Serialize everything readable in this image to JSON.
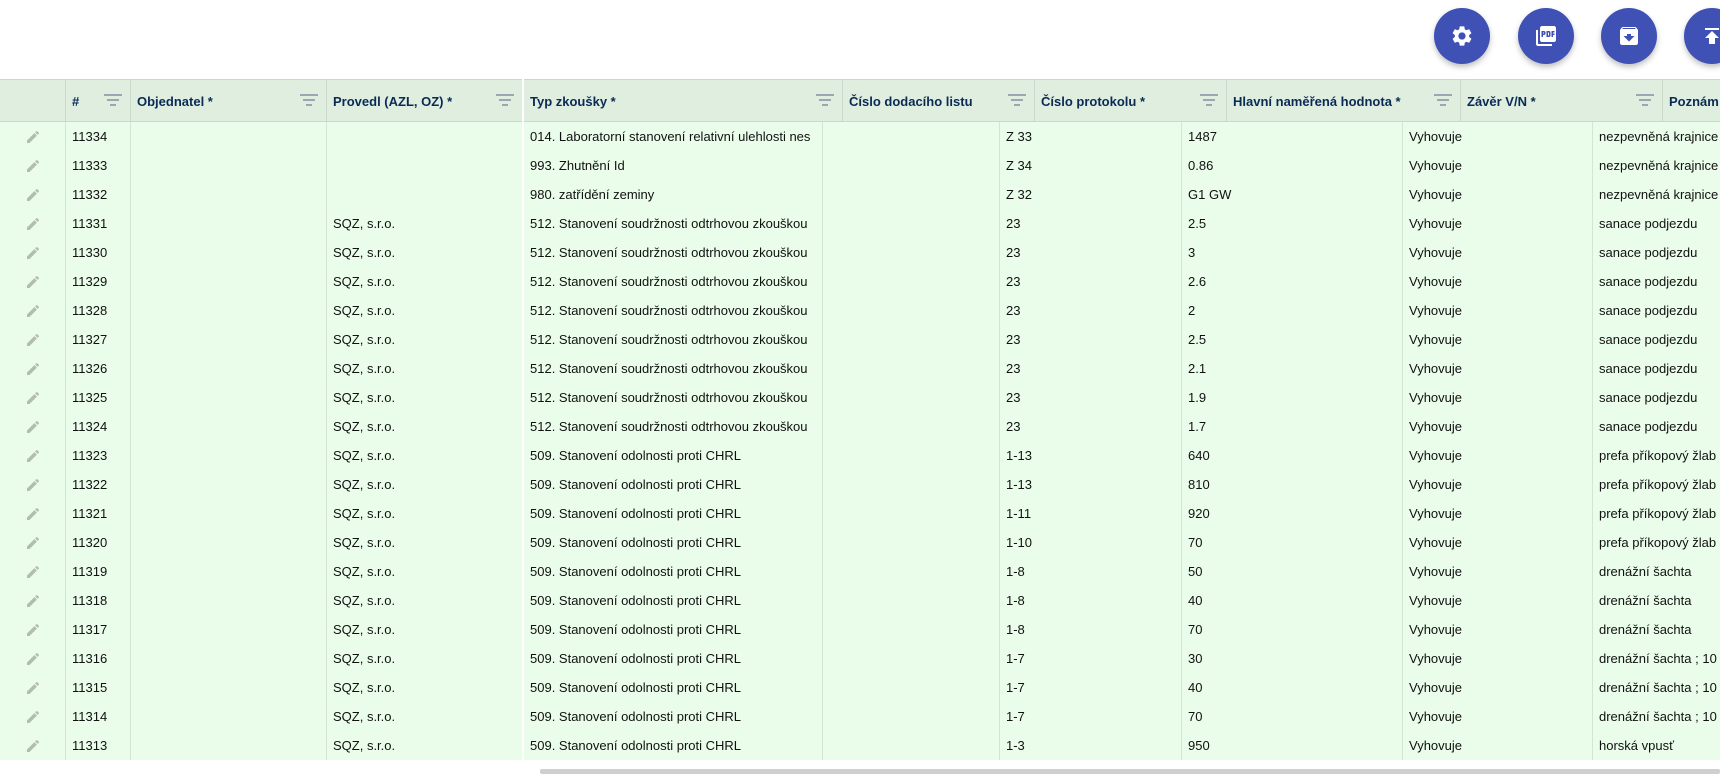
{
  "toolbar": {
    "buttons": [
      {
        "icon": "gear-icon"
      },
      {
        "icon": "pdf-icon"
      },
      {
        "icon": "archive-download-icon"
      },
      {
        "icon": "upload-icon"
      }
    ]
  },
  "colors": {
    "fab": "#3f51b5",
    "header_bg": "#dfeedf",
    "row_bg": "#e9fdea",
    "header_text": "#0a2a55"
  },
  "columns": [
    {
      "key": "edit",
      "label": ""
    },
    {
      "key": "id",
      "label": "#"
    },
    {
      "key": "objednatel",
      "label": "Objednatel *"
    },
    {
      "key": "provedl",
      "label": "Provedl (AZL, OZ) *"
    },
    {
      "key": "typ",
      "label": "Typ zkoušky *"
    },
    {
      "key": "dodaci",
      "label": "Číslo dodacího listu"
    },
    {
      "key": "protokol",
      "label": "Číslo protokolu *"
    },
    {
      "key": "hodnota",
      "label": "Hlavní naměřená hodnota *"
    },
    {
      "key": "zaver",
      "label": "Závěr V/N *"
    },
    {
      "key": "poznamka",
      "label": "Poznám"
    }
  ],
  "rows": [
    {
      "id": "11334",
      "objednatel": "",
      "provedl": "",
      "typ": "014. Laboratorní stanovení relativní ulehlosti nes",
      "dodaci": "",
      "protokol": "Z 33",
      "hodnota": "1487",
      "zaver": "Vyhovuje",
      "poznamka": "nezpevněná krajnice"
    },
    {
      "id": "11333",
      "objednatel": "",
      "provedl": "",
      "typ": "993. Zhutnění Id",
      "dodaci": "",
      "protokol": "Z 34",
      "hodnota": "0.86",
      "zaver": "Vyhovuje",
      "poznamka": "nezpevněná krajnice"
    },
    {
      "id": "11332",
      "objednatel": "",
      "provedl": "",
      "typ": "980. zatřídění zeminy",
      "dodaci": "",
      "protokol": "Z 32",
      "hodnota": "G1 GW",
      "zaver": "Vyhovuje",
      "poznamka": "nezpevněná krajnice"
    },
    {
      "id": "11331",
      "objednatel": "",
      "provedl": "SQZ, s.r.o.",
      "typ": "512. Stanovení soudržnosti odtrhovou zkouškou",
      "dodaci": "",
      "protokol": "23",
      "hodnota": "2.5",
      "zaver": "Vyhovuje",
      "poznamka": "sanace podjezdu"
    },
    {
      "id": "11330",
      "objednatel": "",
      "provedl": "SQZ, s.r.o.",
      "typ": "512. Stanovení soudržnosti odtrhovou zkouškou",
      "dodaci": "",
      "protokol": "23",
      "hodnota": "3",
      "zaver": "Vyhovuje",
      "poznamka": "sanace podjezdu"
    },
    {
      "id": "11329",
      "objednatel": "",
      "provedl": "SQZ, s.r.o.",
      "typ": "512. Stanovení soudržnosti odtrhovou zkouškou",
      "dodaci": "",
      "protokol": "23",
      "hodnota": "2.6",
      "zaver": "Vyhovuje",
      "poznamka": "sanace podjezdu"
    },
    {
      "id": "11328",
      "objednatel": "",
      "provedl": "SQZ, s.r.o.",
      "typ": "512. Stanovení soudržnosti odtrhovou zkouškou",
      "dodaci": "",
      "protokol": "23",
      "hodnota": "2",
      "zaver": "Vyhovuje",
      "poznamka": "sanace podjezdu"
    },
    {
      "id": "11327",
      "objednatel": "",
      "provedl": "SQZ, s.r.o.",
      "typ": "512. Stanovení soudržnosti odtrhovou zkouškou",
      "dodaci": "",
      "protokol": "23",
      "hodnota": "2.5",
      "zaver": "Vyhovuje",
      "poznamka": "sanace podjezdu"
    },
    {
      "id": "11326",
      "objednatel": "",
      "provedl": "SQZ, s.r.o.",
      "typ": "512. Stanovení soudržnosti odtrhovou zkouškou",
      "dodaci": "",
      "protokol": "23",
      "hodnota": "2.1",
      "zaver": "Vyhovuje",
      "poznamka": "sanace podjezdu"
    },
    {
      "id": "11325",
      "objednatel": "",
      "provedl": "SQZ, s.r.o.",
      "typ": "512. Stanovení soudržnosti odtrhovou zkouškou",
      "dodaci": "",
      "protokol": "23",
      "hodnota": "1.9",
      "zaver": "Vyhovuje",
      "poznamka": "sanace podjezdu"
    },
    {
      "id": "11324",
      "objednatel": "",
      "provedl": "SQZ, s.r.o.",
      "typ": "512. Stanovení soudržnosti odtrhovou zkouškou",
      "dodaci": "",
      "protokol": "23",
      "hodnota": "1.7",
      "zaver": "Vyhovuje",
      "poznamka": "sanace podjezdu"
    },
    {
      "id": "11323",
      "objednatel": "",
      "provedl": "SQZ, s.r.o.",
      "typ": "509. Stanovení odolnosti proti CHRL",
      "dodaci": "",
      "protokol": "1-13",
      "hodnota": "640",
      "zaver": "Vyhovuje",
      "poznamka": "prefa příkopový žlab"
    },
    {
      "id": "11322",
      "objednatel": "",
      "provedl": "SQZ, s.r.o.",
      "typ": "509. Stanovení odolnosti proti CHRL",
      "dodaci": "",
      "protokol": "1-13",
      "hodnota": "810",
      "zaver": "Vyhovuje",
      "poznamka": "prefa příkopový žlab"
    },
    {
      "id": "11321",
      "objednatel": "",
      "provedl": "SQZ, s.r.o.",
      "typ": "509. Stanovení odolnosti proti CHRL",
      "dodaci": "",
      "protokol": "1-11",
      "hodnota": "920",
      "zaver": "Vyhovuje",
      "poznamka": "prefa příkopový žlab"
    },
    {
      "id": "11320",
      "objednatel": "",
      "provedl": "SQZ, s.r.o.",
      "typ": "509. Stanovení odolnosti proti CHRL",
      "dodaci": "",
      "protokol": "1-10",
      "hodnota": "70",
      "zaver": "Vyhovuje",
      "poznamka": "prefa příkopový žlab"
    },
    {
      "id": "11319",
      "objednatel": "",
      "provedl": "SQZ, s.r.o.",
      "typ": "509. Stanovení odolnosti proti CHRL",
      "dodaci": "",
      "protokol": "1-8",
      "hodnota": "50",
      "zaver": "Vyhovuje",
      "poznamka": "drenážní šachta"
    },
    {
      "id": "11318",
      "objednatel": "",
      "provedl": "SQZ, s.r.o.",
      "typ": "509. Stanovení odolnosti proti CHRL",
      "dodaci": "",
      "protokol": "1-8",
      "hodnota": "40",
      "zaver": "Vyhovuje",
      "poznamka": "drenážní šachta"
    },
    {
      "id": "11317",
      "objednatel": "",
      "provedl": "SQZ, s.r.o.",
      "typ": "509. Stanovení odolnosti proti CHRL",
      "dodaci": "",
      "protokol": "1-8",
      "hodnota": "70",
      "zaver": "Vyhovuje",
      "poznamka": "drenážní šachta"
    },
    {
      "id": "11316",
      "objednatel": "",
      "provedl": "SQZ, s.r.o.",
      "typ": "509. Stanovení odolnosti proti CHRL",
      "dodaci": "",
      "protokol": "1-7",
      "hodnota": "30",
      "zaver": "Vyhovuje",
      "poznamka": "drenážní šachta ; 10"
    },
    {
      "id": "11315",
      "objednatel": "",
      "provedl": "SQZ, s.r.o.",
      "typ": "509. Stanovení odolnosti proti CHRL",
      "dodaci": "",
      "protokol": "1-7",
      "hodnota": "40",
      "zaver": "Vyhovuje",
      "poznamka": "drenážní šachta ; 10"
    },
    {
      "id": "11314",
      "objednatel": "",
      "provedl": "SQZ, s.r.o.",
      "typ": "509. Stanovení odolnosti proti CHRL",
      "dodaci": "",
      "protokol": "1-7",
      "hodnota": "70",
      "zaver": "Vyhovuje",
      "poznamka": "drenážní šachta ; 10"
    },
    {
      "id": "11313",
      "objednatel": "",
      "provedl": "SQZ, s.r.o.",
      "typ": "509. Stanovení odolnosti proti CHRL",
      "dodaci": "",
      "protokol": "1-3",
      "hodnota": "950",
      "zaver": "Vyhovuje",
      "poznamka": "horská vpusť"
    }
  ]
}
